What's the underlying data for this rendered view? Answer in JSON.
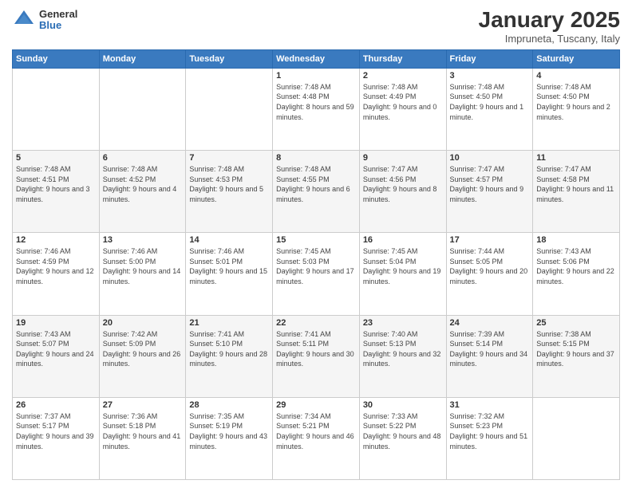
{
  "header": {
    "logo": {
      "general": "General",
      "blue": "Blue"
    },
    "title": "January 2025",
    "subtitle": "Impruneta, Tuscany, Italy"
  },
  "weekdays": [
    "Sunday",
    "Monday",
    "Tuesday",
    "Wednesday",
    "Thursday",
    "Friday",
    "Saturday"
  ],
  "weeks": [
    [
      {
        "day": "",
        "info": ""
      },
      {
        "day": "",
        "info": ""
      },
      {
        "day": "",
        "info": ""
      },
      {
        "day": "1",
        "info": "Sunrise: 7:48 AM\nSunset: 4:48 PM\nDaylight: 8 hours and 59 minutes."
      },
      {
        "day": "2",
        "info": "Sunrise: 7:48 AM\nSunset: 4:49 PM\nDaylight: 9 hours and 0 minutes."
      },
      {
        "day": "3",
        "info": "Sunrise: 7:48 AM\nSunset: 4:50 PM\nDaylight: 9 hours and 1 minute."
      },
      {
        "day": "4",
        "info": "Sunrise: 7:48 AM\nSunset: 4:50 PM\nDaylight: 9 hours and 2 minutes."
      }
    ],
    [
      {
        "day": "5",
        "info": "Sunrise: 7:48 AM\nSunset: 4:51 PM\nDaylight: 9 hours and 3 minutes."
      },
      {
        "day": "6",
        "info": "Sunrise: 7:48 AM\nSunset: 4:52 PM\nDaylight: 9 hours and 4 minutes."
      },
      {
        "day": "7",
        "info": "Sunrise: 7:48 AM\nSunset: 4:53 PM\nDaylight: 9 hours and 5 minutes."
      },
      {
        "day": "8",
        "info": "Sunrise: 7:48 AM\nSunset: 4:55 PM\nDaylight: 9 hours and 6 minutes."
      },
      {
        "day": "9",
        "info": "Sunrise: 7:47 AM\nSunset: 4:56 PM\nDaylight: 9 hours and 8 minutes."
      },
      {
        "day": "10",
        "info": "Sunrise: 7:47 AM\nSunset: 4:57 PM\nDaylight: 9 hours and 9 minutes."
      },
      {
        "day": "11",
        "info": "Sunrise: 7:47 AM\nSunset: 4:58 PM\nDaylight: 9 hours and 11 minutes."
      }
    ],
    [
      {
        "day": "12",
        "info": "Sunrise: 7:46 AM\nSunset: 4:59 PM\nDaylight: 9 hours and 12 minutes."
      },
      {
        "day": "13",
        "info": "Sunrise: 7:46 AM\nSunset: 5:00 PM\nDaylight: 9 hours and 14 minutes."
      },
      {
        "day": "14",
        "info": "Sunrise: 7:46 AM\nSunset: 5:01 PM\nDaylight: 9 hours and 15 minutes."
      },
      {
        "day": "15",
        "info": "Sunrise: 7:45 AM\nSunset: 5:03 PM\nDaylight: 9 hours and 17 minutes."
      },
      {
        "day": "16",
        "info": "Sunrise: 7:45 AM\nSunset: 5:04 PM\nDaylight: 9 hours and 19 minutes."
      },
      {
        "day": "17",
        "info": "Sunrise: 7:44 AM\nSunset: 5:05 PM\nDaylight: 9 hours and 20 minutes."
      },
      {
        "day": "18",
        "info": "Sunrise: 7:43 AM\nSunset: 5:06 PM\nDaylight: 9 hours and 22 minutes."
      }
    ],
    [
      {
        "day": "19",
        "info": "Sunrise: 7:43 AM\nSunset: 5:07 PM\nDaylight: 9 hours and 24 minutes."
      },
      {
        "day": "20",
        "info": "Sunrise: 7:42 AM\nSunset: 5:09 PM\nDaylight: 9 hours and 26 minutes."
      },
      {
        "day": "21",
        "info": "Sunrise: 7:41 AM\nSunset: 5:10 PM\nDaylight: 9 hours and 28 minutes."
      },
      {
        "day": "22",
        "info": "Sunrise: 7:41 AM\nSunset: 5:11 PM\nDaylight: 9 hours and 30 minutes."
      },
      {
        "day": "23",
        "info": "Sunrise: 7:40 AM\nSunset: 5:13 PM\nDaylight: 9 hours and 32 minutes."
      },
      {
        "day": "24",
        "info": "Sunrise: 7:39 AM\nSunset: 5:14 PM\nDaylight: 9 hours and 34 minutes."
      },
      {
        "day": "25",
        "info": "Sunrise: 7:38 AM\nSunset: 5:15 PM\nDaylight: 9 hours and 37 minutes."
      }
    ],
    [
      {
        "day": "26",
        "info": "Sunrise: 7:37 AM\nSunset: 5:17 PM\nDaylight: 9 hours and 39 minutes."
      },
      {
        "day": "27",
        "info": "Sunrise: 7:36 AM\nSunset: 5:18 PM\nDaylight: 9 hours and 41 minutes."
      },
      {
        "day": "28",
        "info": "Sunrise: 7:35 AM\nSunset: 5:19 PM\nDaylight: 9 hours and 43 minutes."
      },
      {
        "day": "29",
        "info": "Sunrise: 7:34 AM\nSunset: 5:21 PM\nDaylight: 9 hours and 46 minutes."
      },
      {
        "day": "30",
        "info": "Sunrise: 7:33 AM\nSunset: 5:22 PM\nDaylight: 9 hours and 48 minutes."
      },
      {
        "day": "31",
        "info": "Sunrise: 7:32 AM\nSunset: 5:23 PM\nDaylight: 9 hours and 51 minutes."
      },
      {
        "day": "",
        "info": ""
      }
    ]
  ]
}
